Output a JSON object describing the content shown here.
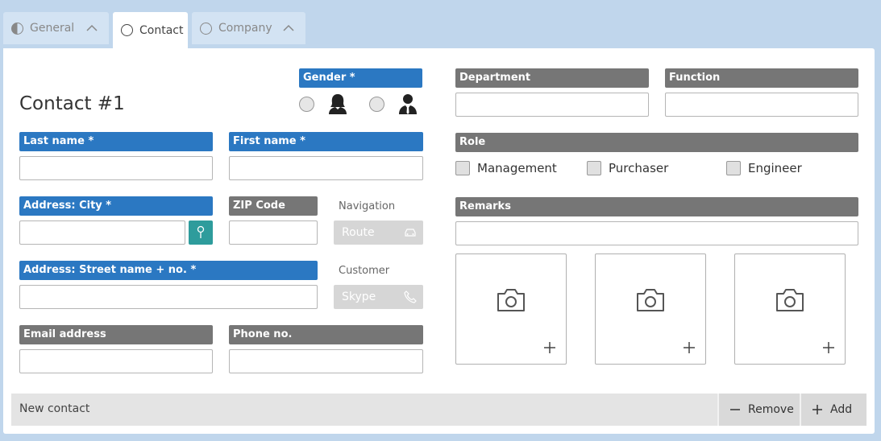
{
  "tabs": [
    {
      "label": "General",
      "icon": "half-circle-icon"
    },
    {
      "label": "Contact",
      "icon": "circle-icon"
    },
    {
      "label": "Company",
      "icon": "circle-icon"
    }
  ],
  "form": {
    "title": "Contact #1",
    "gender_label": "Gender *",
    "last_name_label": "Last name *",
    "first_name_label": "First name *",
    "city_label": "Address: City *",
    "zip_label": "ZIP Code",
    "navigation_label": "Navigation",
    "route_button": "Route",
    "street_label": "Address: Street name + no. *",
    "customer_label": "Customer",
    "skype_button": "Skype",
    "email_label": "Email address",
    "phone_label": "Phone no.",
    "department_label": "Department",
    "function_label": "Function",
    "role_label": "Role",
    "roles": [
      "Management",
      "Purchaser",
      "Engineer"
    ],
    "remarks_label": "Remarks"
  },
  "footer": {
    "status": "New contact",
    "remove_button": "Remove",
    "add_button": "Add"
  },
  "colors": {
    "required_label": "#2b78c2",
    "optional_label": "#767676",
    "map_button": "#2e9c9c",
    "background": "#c0d6ec"
  }
}
